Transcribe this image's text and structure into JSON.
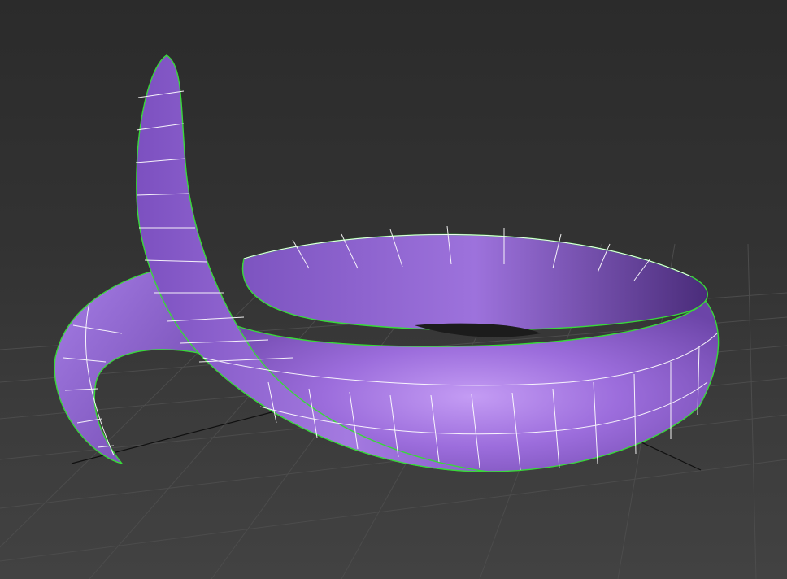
{
  "viewport": {
    "view": "perspective",
    "background_color": "#2f2f2f",
    "grid_visible": true
  },
  "model": {
    "type": "curled-band",
    "shading": "edged-faces",
    "face_color": "#9b6bdc",
    "highlight_color": "#c9a6f5",
    "shadow_color": "#5a3a8a",
    "wire_color": "#ffffff",
    "selection_outline_color": "#39d83a"
  },
  "grid": {
    "line_color": "#4a4a4a",
    "axis_color": "#111111"
  }
}
